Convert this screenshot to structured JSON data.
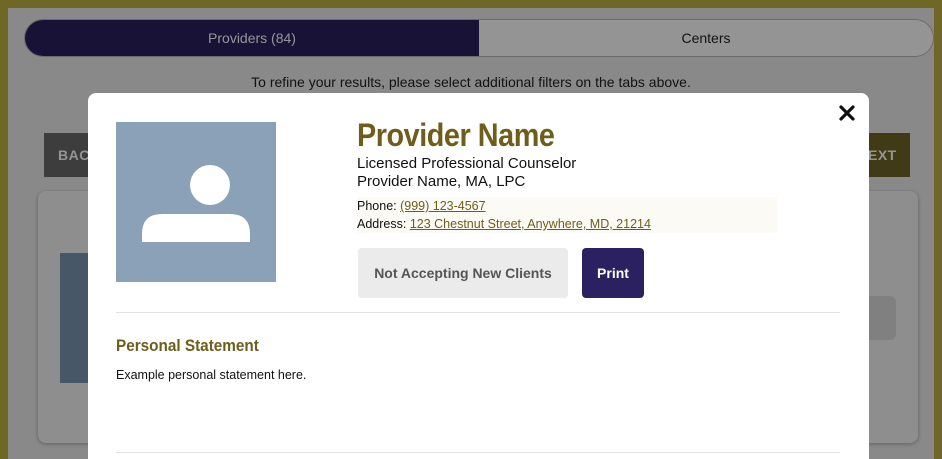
{
  "tabs": [
    {
      "label": "Providers (84)",
      "active": true
    },
    {
      "label": "Centers",
      "active": false
    }
  ],
  "refine_text": "To refine your results, please select additional filters on the tabs above.",
  "nav": {
    "back_label": "BAC",
    "next_label": "EXT"
  },
  "modal": {
    "close_glyph": "✕",
    "name": "Provider Name",
    "title": "Licensed Professional Counselor",
    "credentials": "Provider Name, MA, LPC",
    "phone_label": "Phone: ",
    "phone": "(999) 123-4567",
    "address_label": "Address: ",
    "address": "123 Chestnut Street, Anywhere, MD, 21214",
    "status_button": "Not Accepting New Clients",
    "print_button": "Print",
    "section_heading": "Personal Statement",
    "statement": "Example personal statement here."
  },
  "colors": {
    "accent_purple": "#2b2060",
    "accent_olive": "#6e5e1c",
    "avatar_bg": "#8aa1b7"
  },
  "icons": {
    "avatar": "user-silhouette-icon",
    "close": "close-icon"
  }
}
